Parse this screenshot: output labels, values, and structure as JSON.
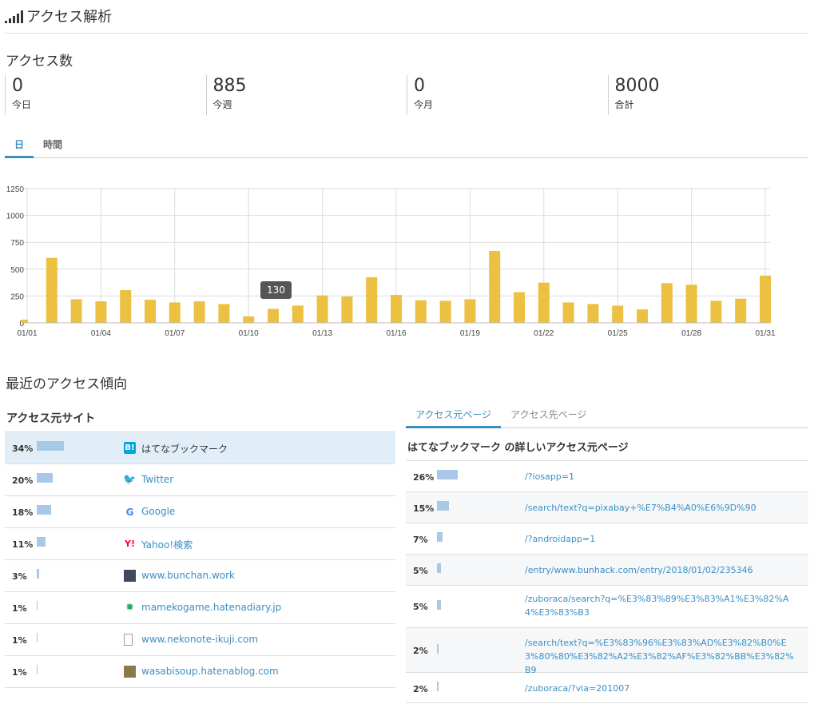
{
  "header": {
    "title": "アクセス解析"
  },
  "access_count": {
    "title": "アクセス数",
    "stats": [
      {
        "value": "0",
        "label": "今日"
      },
      {
        "value": "885",
        "label": "今週"
      },
      {
        "value": "0",
        "label": "今月"
      },
      {
        "value": "8000",
        "label": "合計"
      }
    ]
  },
  "range_tabs": [
    {
      "label": "日",
      "active": true
    },
    {
      "label": "時間",
      "active": false
    }
  ],
  "chart_data": {
    "type": "bar",
    "color": "#ecc040",
    "ylim": [
      0,
      1250
    ],
    "yticks": [
      0,
      250,
      500,
      750,
      1000,
      1250
    ],
    "categories": [
      "01/01",
      "01/02",
      "01/03",
      "01/04",
      "01/05",
      "01/06",
      "01/07",
      "01/08",
      "01/09",
      "01/10",
      "01/11",
      "01/12",
      "01/13",
      "01/14",
      "01/15",
      "01/16",
      "01/17",
      "01/18",
      "01/19",
      "01/20",
      "01/21",
      "01/22",
      "01/23",
      "01/24",
      "01/25",
      "01/26",
      "01/27",
      "01/28",
      "01/29",
      "01/30",
      "01/31"
    ],
    "xtick_labels": [
      "01/01",
      "01/04",
      "01/07",
      "01/10",
      "01/13",
      "01/16",
      "01/19",
      "01/22",
      "01/25",
      "01/28",
      "01/31"
    ],
    "values": [
      30,
      605,
      220,
      200,
      305,
      215,
      190,
      200,
      175,
      60,
      130,
      160,
      255,
      245,
      425,
      260,
      210,
      205,
      220,
      670,
      285,
      375,
      190,
      175,
      160,
      125,
      370,
      355,
      205,
      225,
      440
    ],
    "tooltip": {
      "category": "01/11",
      "value": "130"
    }
  },
  "trend": {
    "title": "最近のアクセス傾向"
  },
  "sources": {
    "title": "アクセス元サイト",
    "rows": [
      {
        "pct": "34%",
        "ratio": 0.34,
        "name": "はてなブックマーク",
        "icon": "hatena-bookmark-icon",
        "selected": true
      },
      {
        "pct": "20%",
        "ratio": 0.2,
        "name": "Twitter",
        "icon": "twitter-icon",
        "selected": false
      },
      {
        "pct": "18%",
        "ratio": 0.18,
        "name": "Google",
        "icon": "google-icon",
        "selected": false
      },
      {
        "pct": "11%",
        "ratio": 0.11,
        "name": "Yahoo!検索",
        "icon": "yahoo-icon",
        "selected": false
      },
      {
        "pct": "3%",
        "ratio": 0.03,
        "name": "www.bunchan.work",
        "icon": "site-avatar-icon",
        "selected": false
      },
      {
        "pct": "1%",
        "ratio": 0.01,
        "name": "mamekogame.hatenadiary.jp",
        "icon": "site-avatar-icon",
        "selected": false
      },
      {
        "pct": "1%",
        "ratio": 0.01,
        "name": "www.nekonote-ikuji.com",
        "icon": "document-icon",
        "selected": false
      },
      {
        "pct": "1%",
        "ratio": 0.01,
        "name": "wasabisoup.hatenablog.com",
        "icon": "site-avatar-icon",
        "selected": false
      }
    ]
  },
  "referrer_tabs": [
    {
      "label": "アクセス元ページ",
      "active": true
    },
    {
      "label": "アクセス先ページ",
      "active": false
    }
  ],
  "referrer_pages": {
    "title": "はてなブックマーク の詳しいアクセス元ページ",
    "rows": [
      {
        "pct": "26%",
        "ratio": 0.26,
        "url": "/?iosapp=1"
      },
      {
        "pct": "15%",
        "ratio": 0.15,
        "url": "/search/text?q=pixabay+%E7%B4%A0%E6%9D%90"
      },
      {
        "pct": "7%",
        "ratio": 0.07,
        "url": "/?androidapp=1"
      },
      {
        "pct": "5%",
        "ratio": 0.05,
        "url": "/entry/www.bunhack.com/entry/2018/01/02/235346"
      },
      {
        "pct": "5%",
        "ratio": 0.05,
        "url": "/zuboraca/search?q=%E3%83%89%E3%83%A1%E3%82%A4%E3%83%B3"
      },
      {
        "pct": "2%",
        "ratio": 0.02,
        "url": "/search/text?q=%E3%83%96%E3%83%AD%E3%82%B0%E3%80%80%E3%82%A2%E3%82%AF%E3%82%BB%E3%82%B9"
      },
      {
        "pct": "2%",
        "ratio": 0.02,
        "url": "/zuboraca/?via=201007"
      }
    ]
  }
}
